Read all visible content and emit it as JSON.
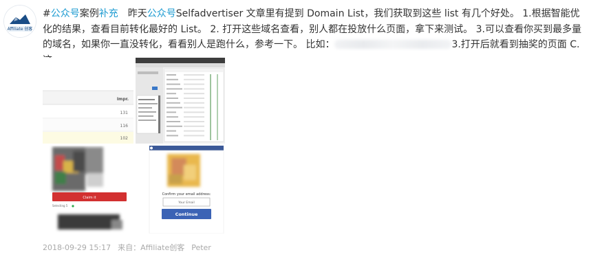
{
  "avatar": {
    "label": "Affiliate 创客"
  },
  "post": {
    "tag": "#",
    "tag_word_1": "公众号",
    "tag_text_1": "案例",
    "tag_word_2": "补充",
    "text_1": "昨天",
    "mention": "公众号",
    "text_2": "Selfadvertiser 文章里有提到 Domain List，我们获取到这些 list 有几个好处。 1.根据智能优化的结果，查看目前转化最好的 List。 2. 打开这些域名查看，别人都在投放什么页面，拿下来测试。 3.可以查看你买到最多量的域名，如果你一直没转化，看看别人是跑什么，参考一下。 比如：",
    "text_3": "3.打开后就看到抽奖的页面 C.这",
    "ellipsis": "..."
  },
  "thumb1": {
    "col_header": "Impr.",
    "values": [
      "131",
      "116",
      "102"
    ]
  },
  "thumb3": {
    "button_label": "Claim it",
    "small_text": "Selecting 5"
  },
  "thumb4": {
    "prompt": "Confirm your email address:",
    "input_placeholder": "Your Email",
    "button_label": "Continue"
  },
  "meta": {
    "timestamp": "2018-09-29 15:17",
    "source": "来自：Affiliate创客",
    "author": "Peter"
  },
  "colors": {
    "link": "#1d9bd1",
    "meta": "#aaaaaa",
    "continue_button": "#3b63b5",
    "claim_button": "#d23030",
    "fb_bar": "#3b5998"
  }
}
